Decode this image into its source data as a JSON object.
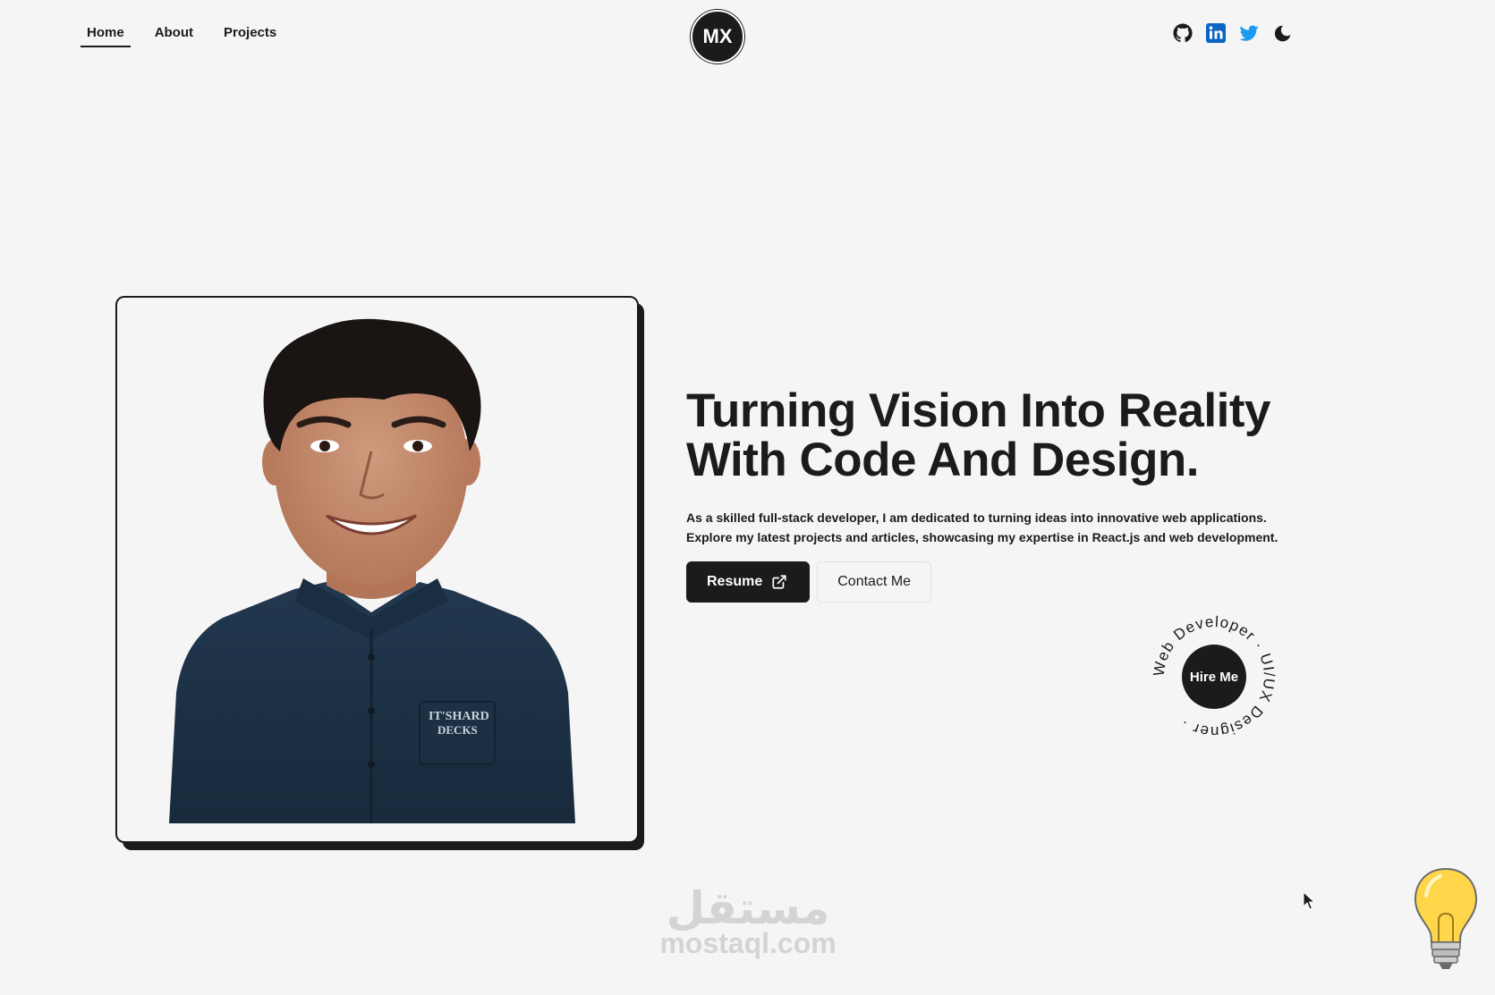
{
  "nav": {
    "links": [
      {
        "label": "Home",
        "active": true
      },
      {
        "label": "About",
        "active": false
      },
      {
        "label": "Projects",
        "active": false
      }
    ],
    "logo": "MX",
    "socials": [
      {
        "icon": "github-icon",
        "color": "#1b1b1b"
      },
      {
        "icon": "linkedin-icon",
        "color": "#0a66c2"
      },
      {
        "icon": "twitter-icon",
        "color": "#1d9bf0"
      },
      {
        "icon": "theme-toggle-moon-icon",
        "color": "#1b1b1b"
      }
    ]
  },
  "hero": {
    "headline_line1": "Turning Vision Into Reality",
    "headline_line2": "With Code And Design.",
    "intro": "As a skilled full-stack developer, I am dedicated to turning ideas into innovative web applications. Explore my latest projects and articles, showcasing my expertise in React.js and web development.",
    "resume_label": "Resume",
    "contact_label": "Contact Me"
  },
  "hire": {
    "label": "Hire Me",
    "ring_text": "Web Developer · UI/UX Designer · "
  },
  "watermark": {
    "arabic": "مستقل",
    "latin": "mostaql.com"
  },
  "colors": {
    "background": "#f5f5f5",
    "dark": "#1b1b1b",
    "linkedin": "#0a66c2",
    "twitter": "#1d9bf0",
    "bulb": "#ffd54a"
  }
}
